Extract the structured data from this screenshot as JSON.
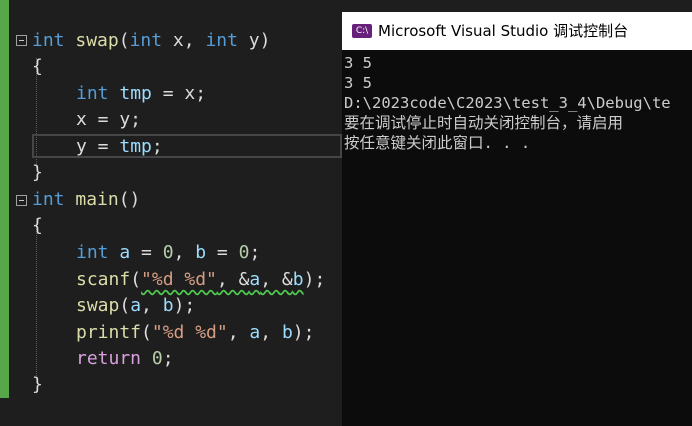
{
  "editor": {
    "lines": [
      {
        "tokens": [
          [
            "kw",
            "int"
          ],
          [
            "id",
            " "
          ],
          [
            "fn",
            "swap"
          ],
          [
            "id",
            "("
          ],
          [
            "kw",
            "int"
          ],
          [
            "id",
            " x, "
          ],
          [
            "kw",
            "int"
          ],
          [
            "id",
            " y)"
          ]
        ]
      },
      {
        "tokens": [
          [
            "id",
            "{"
          ]
        ]
      },
      {
        "tokens": [
          [
            "kw",
            "int"
          ],
          [
            "id",
            " "
          ],
          [
            "var",
            "tmp"
          ],
          [
            "id",
            " = x;"
          ]
        ]
      },
      {
        "tokens": [
          [
            "id",
            "x = y;"
          ]
        ]
      },
      {
        "tokens": [
          [
            "id",
            "y = "
          ],
          [
            "var",
            "tmp"
          ],
          [
            "id",
            ";"
          ]
        ]
      },
      {
        "tokens": [
          [
            "id",
            "}"
          ]
        ]
      },
      {
        "tokens": [
          [
            "kw",
            "int"
          ],
          [
            "id",
            " "
          ],
          [
            "fn",
            "main"
          ],
          [
            "id",
            "()"
          ]
        ]
      },
      {
        "tokens": [
          [
            "id",
            "{"
          ]
        ]
      },
      {
        "tokens": [
          [
            "kw",
            "int"
          ],
          [
            "id",
            " "
          ],
          [
            "var",
            "a"
          ],
          [
            "id",
            " = "
          ],
          [
            "num",
            "0"
          ],
          [
            "id",
            ", "
          ],
          [
            "var",
            "b"
          ],
          [
            "id",
            " = "
          ],
          [
            "num",
            "0"
          ],
          [
            "id",
            ";"
          ]
        ]
      },
      {
        "tokens": [
          [
            "fn",
            "scanf"
          ],
          [
            "id",
            "("
          ],
          [
            "str",
            "\"%d %d\""
          ],
          [
            "id",
            ", &"
          ],
          [
            "var",
            "a"
          ],
          [
            "id",
            ", &"
          ],
          [
            "var",
            "b"
          ],
          [
            "id",
            ");"
          ]
        ]
      },
      {
        "tokens": [
          [
            "fn",
            "swap"
          ],
          [
            "id",
            "("
          ],
          [
            "var",
            "a"
          ],
          [
            "id",
            ", "
          ],
          [
            "var",
            "b"
          ],
          [
            "id",
            ");"
          ]
        ]
      },
      {
        "tokens": [
          [
            "fn",
            "printf"
          ],
          [
            "id",
            "("
          ],
          [
            "str",
            "\"%d %d\""
          ],
          [
            "id",
            ", "
          ],
          [
            "var",
            "a"
          ],
          [
            "id",
            ", "
          ],
          [
            "var",
            "b"
          ],
          [
            "id",
            ");"
          ]
        ]
      },
      {
        "tokens": [
          [
            "ctl",
            "return"
          ],
          [
            "id",
            " "
          ],
          [
            "num",
            "0"
          ],
          [
            "id",
            ";"
          ]
        ]
      },
      {
        "tokens": [
          [
            "id",
            "}"
          ]
        ]
      }
    ]
  },
  "console": {
    "icon_label": "C:\\",
    "title": "Microsoft Visual Studio 调试控制台",
    "lines": [
      "3 5",
      "3 5",
      "D:\\2023code\\C2023\\test_3_4\\Debug\\te",
      "要在调试停止时自动关闭控制台，请启用",
      "按任意键关闭此窗口. . ."
    ]
  },
  "colors": {
    "editor_bg": "#1e1e1e",
    "keyword": "#569cd6",
    "function": "#dcdcaa",
    "variable": "#9cdcfe",
    "string": "#d69d85",
    "number": "#b5cea8",
    "control": "#d8a0df",
    "change_margin": "#57a64a",
    "console_bg": "#0c0c0c",
    "console_text": "#cccccc",
    "vs_purple": "#68217a"
  }
}
